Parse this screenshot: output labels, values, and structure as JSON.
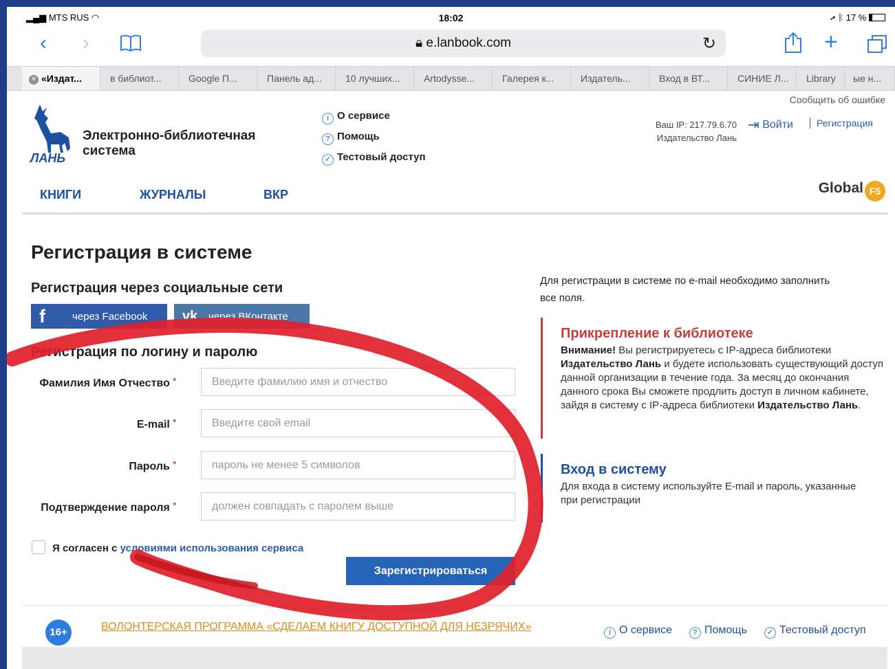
{
  "status_bar": {
    "carrier": "MTS RUS",
    "time": "18:02",
    "battery": "17 %"
  },
  "browser": {
    "url": "e.lanbook.com",
    "tabs": [
      {
        "label": "«Издат..."
      },
      {
        "label": "в библиот..."
      },
      {
        "label": "Google П..."
      },
      {
        "label": "Панель ад..."
      },
      {
        "label": "10 лучших..."
      },
      {
        "label": "Artodysse..."
      },
      {
        "label": "Галерея к..."
      },
      {
        "label": "Издатель..."
      },
      {
        "label": "Вход в ВТ..."
      },
      {
        "label": "СИНИЕ Л..."
      },
      {
        "label": "Library"
      },
      {
        "label": "ые н..."
      }
    ]
  },
  "header": {
    "report_error": "Сообщить об ошибке",
    "logo_text": "ЛАНЬ",
    "site_title_line1": "Электронно-библиотечная",
    "site_title_line2": "система",
    "service_links": [
      "О сервисе",
      "Помощь",
      "Тестовый доступ"
    ],
    "ip_line": "Ваш IP: 217.79.6.70",
    "org_line": "Издательство Лань",
    "login_label": "Войти",
    "register_label": "Регистрация",
    "nav": [
      "КНИГИ",
      "ЖУРНАЛЫ",
      "ВКР"
    ],
    "global_label": "Global",
    "global_badge": "F5"
  },
  "main": {
    "page_title": "Регистрация в системе",
    "social_title": "Регистрация через социальные сети",
    "facebook_label": "через Facebook",
    "vk_label": "через ВКонтакте",
    "login_title": "Регистрация по логину и паролю",
    "fields": [
      {
        "label": "Фамилия Имя Отчество",
        "placeholder": "Введите фамилию имя и отчество"
      },
      {
        "label": "E-mail",
        "placeholder": "Введите свой email"
      },
      {
        "label": "Пароль",
        "placeholder": "пароль не менее 5 символов"
      },
      {
        "label": "Подтверждение пароля",
        "placeholder": "должен совпадать с паролем выше"
      }
    ],
    "required_mark": "*",
    "agree_prefix": "Я согласен с ",
    "agree_link": "условиями использования сервиса",
    "submit_label": "Зарегистрироваться"
  },
  "sidebar": {
    "email_note": "Для регистрации в системе по e-mail необходимо заполнить все поля.",
    "attach": {
      "title": "Прикрепление к библиотеке",
      "warning": "Внимание!",
      "text1": " Вы регистрируетесь с IP-адреса библиотеки ",
      "org1": "Издательство Лань",
      "text2": " и будете использовать существующий доступ данной организации в течение года. За месяц до окончания данного срока Вы сможете продлить доступ в личном кабинете, зайдя в систему с IP-адреса библиотеки ",
      "org2": "Издательство Лань",
      "text3": "."
    },
    "login": {
      "title": "Вход в систему",
      "text": "Для входа в систему используйте E-mail и пароль, указанные при регистрации"
    }
  },
  "footer": {
    "age_badge": "16+",
    "volunteer": "ВОЛОНТЕРСКАЯ ПРОГРАММА «СДЕЛАЕМ КНИГУ ДОСТУПНОЙ ДЛЯ НЕЗРЯЧИХ»",
    "links": [
      "О сервисе",
      "Помощь",
      "Тестовый доступ"
    ]
  },
  "colors": {
    "accent": "#1e50a2",
    "marker": "#e0202a",
    "facebook": "#2f5ba8",
    "vk": "#4a76a8",
    "warning_title": "#c83e3e"
  }
}
